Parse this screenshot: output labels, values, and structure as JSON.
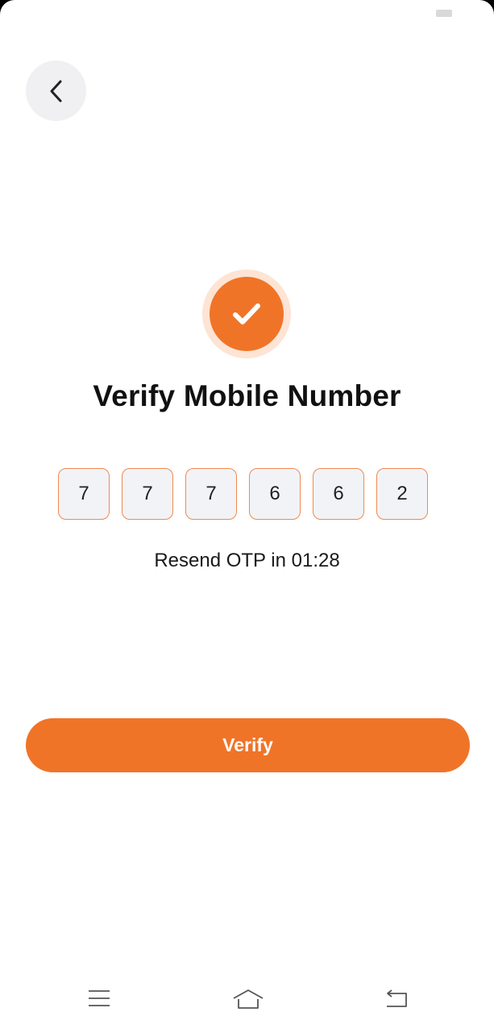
{
  "status_bar": {
    "battery_icon": "battery-icon"
  },
  "header": {
    "back_icon": "chevron-left-icon"
  },
  "badge": {
    "icon": "check-icon",
    "color": "#f07428",
    "halo_color": "#fde4d4"
  },
  "title": "Verify Mobile Number",
  "otp": {
    "digits": [
      "7",
      "7",
      "7",
      "6",
      "6",
      "2"
    ],
    "border_color": "#ef8a4f"
  },
  "resend_text": "Resend OTP in 01:28",
  "verify_button": {
    "label": "Verify",
    "color": "#f07428"
  },
  "nav_bar": {
    "icons": [
      "menu-icon",
      "home-icon",
      "back-icon"
    ]
  }
}
